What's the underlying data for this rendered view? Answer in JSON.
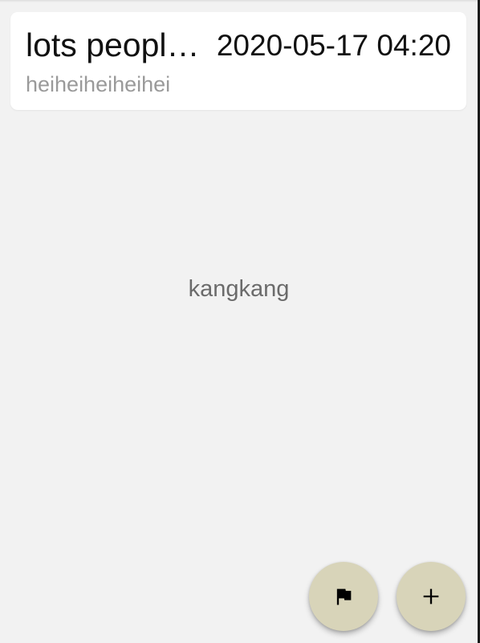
{
  "card": {
    "title": "lots people come here",
    "date": "2020-05-17 04:20",
    "subtitle": "heiheiheiheihei"
  },
  "main": {
    "center_text": "kangkang"
  },
  "fabs": {
    "flag": {
      "icon": "flag-icon"
    },
    "add": {
      "icon": "plus-icon"
    }
  },
  "colors": {
    "background": "#f2f2f2",
    "card": "#ffffff",
    "fab": "#d8d4b9",
    "subtitle": "#9a9a9a",
    "center_text": "#6b6b6b"
  }
}
